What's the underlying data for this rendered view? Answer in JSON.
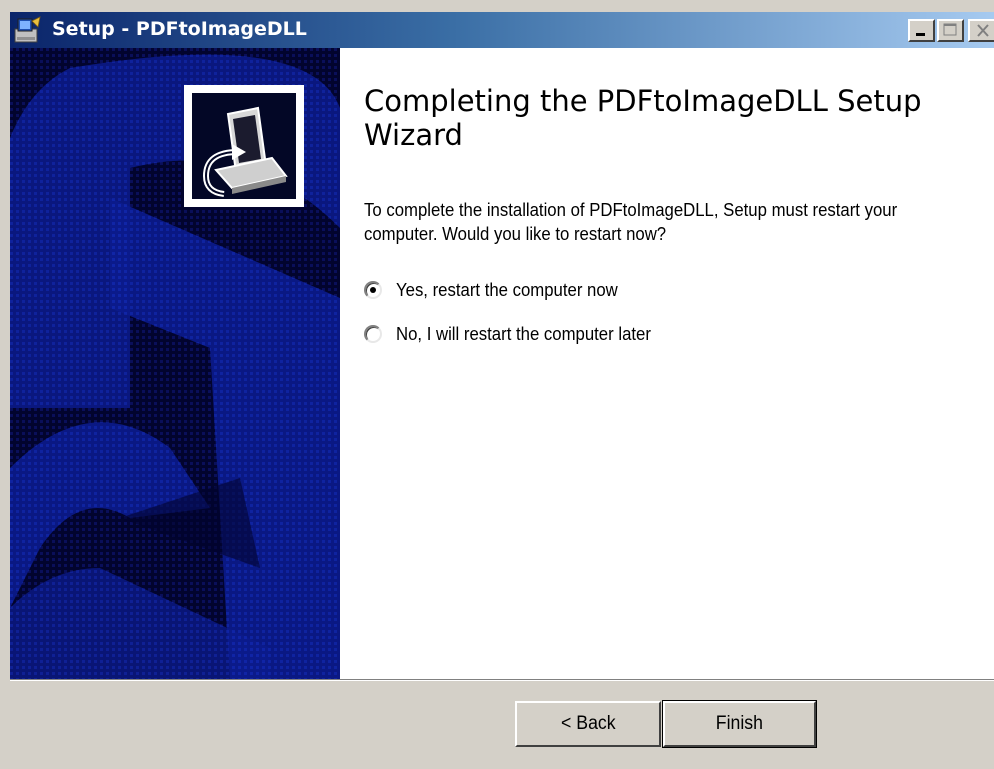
{
  "window": {
    "title": "Setup - PDFtoImageDLL",
    "app_icon": "setup-wizard-icon",
    "controls": {
      "minimize": "minimize-icon",
      "maximize": "maximize-icon",
      "close": "close-icon"
    },
    "colors": {
      "titlebar_start": "#0a246a",
      "titlebar_end": "#a6caf0",
      "banner_bg": "#02042e",
      "banner_accent": "#0b1a8c",
      "face": "#d4d0c8"
    }
  },
  "banner": {
    "icon": "computer-install-icon"
  },
  "content": {
    "heading": "Completing the PDFtoImageDLL Setup Wizard",
    "description": "To complete the installation of PDFtoImageDLL, Setup must restart your computer. Would you like to restart now?",
    "options": [
      {
        "label": "Yes, restart the computer now",
        "selected": true
      },
      {
        "label": "No, I will restart the computer later",
        "selected": false
      }
    ]
  },
  "buttons": {
    "back": "< Back",
    "finish": "Finish"
  }
}
